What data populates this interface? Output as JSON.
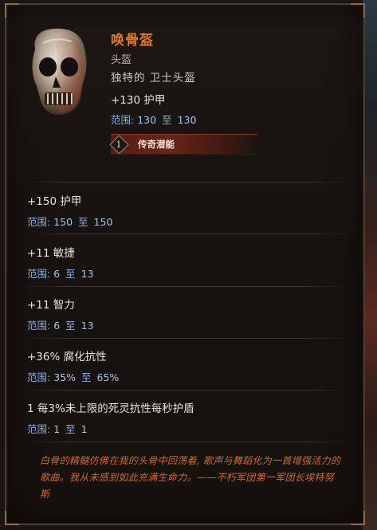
{
  "item": {
    "name": "唤骨盔",
    "slot": "头盔",
    "type": "独特的 卫士头盔",
    "base_stat": "+130 护甲",
    "base_range": {
      "label": "范围:",
      "min": "130",
      "to": "至",
      "max": "130"
    },
    "legendary": {
      "number": "1",
      "label": "传奇潜能"
    }
  },
  "affixes": [
    {
      "stat": "+150 护甲",
      "range": {
        "label": "范围:",
        "min": "150",
        "to": "至",
        "max": "150"
      }
    },
    {
      "stat": "+11 敏捷",
      "range": {
        "label": "范围:",
        "min": "6",
        "to": "至",
        "max": "13"
      }
    },
    {
      "stat": "+11 智力",
      "range": {
        "label": "范围:",
        "min": "6",
        "to": "至",
        "max": "13"
      }
    },
    {
      "stat": "+36% 腐化抗性",
      "range": {
        "label": "范围:",
        "min": "35%",
        "to": "至",
        "max": "65%"
      }
    },
    {
      "stat": "1 每3%未上限的死灵抗性每秒护盾",
      "range": {
        "label": "范围:",
        "min": "1",
        "to": "至",
        "max": "1"
      }
    }
  ],
  "flavor_text": "白骨的精髓仿佛在我的头骨中回荡着, 歌声与舞蹈化为一首增强活力的歌曲。我从未感到如此充满生命力。——不朽军团第一军团长埃特努斯",
  "colors": {
    "item_name": "#e07a2c",
    "range_label": "#8ab0e8",
    "flavor": "#d06a2a"
  },
  "icons": {
    "item": "skull-helmet-icon"
  }
}
